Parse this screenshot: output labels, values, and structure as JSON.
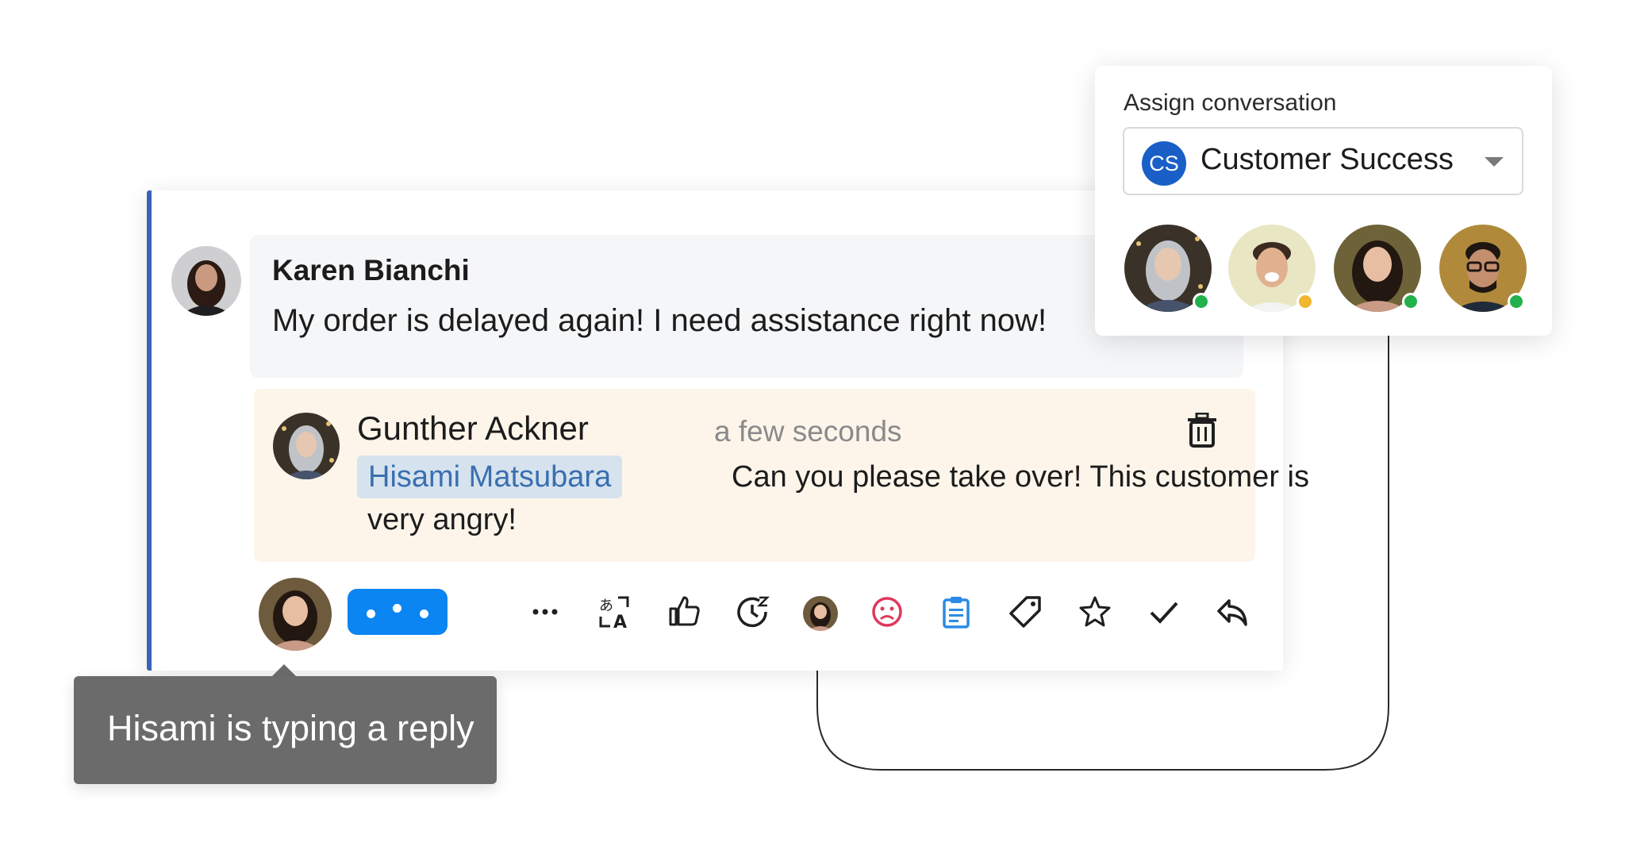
{
  "conversation": {
    "customer_message": {
      "author": "Karen Bianchi",
      "text": "My order is delayed again! I need assistance right now!"
    },
    "internal_note": {
      "author": "Gunther Ackner",
      "time": "a few seconds",
      "mention": "Hisami Matsubara",
      "text_line1": "Can you please take over! This customer is",
      "text_line2": "very angry!"
    },
    "toolbar": {
      "icons": [
        "more-icon",
        "translate-icon",
        "thumbs-up-icon",
        "snooze-icon",
        "assignee-avatar",
        "sad-face-icon",
        "clipboard-icon",
        "tag-icon",
        "star-icon",
        "check-icon",
        "reply-icon"
      ],
      "sad_face_color": "#e0385c",
      "clipboard_color": "#2a8be6"
    }
  },
  "tooltip": {
    "text": "Hisami is typing a reply"
  },
  "assign": {
    "label": "Assign conversation",
    "team_initials": "CS",
    "team_name": "Customer Success",
    "agents": [
      {
        "name": "agent-1",
        "status": "online",
        "status_color": "#22b14c"
      },
      {
        "name": "agent-2",
        "status": "away",
        "status_color": "#f2b632"
      },
      {
        "name": "agent-3",
        "status": "online",
        "status_color": "#22b14c"
      },
      {
        "name": "agent-4",
        "status": "online",
        "status_color": "#22b14c"
      }
    ]
  },
  "colors": {
    "accent": "#3a62b8",
    "typing_bubble": "#0a85f2",
    "note_background": "#fdf5ea",
    "mention_background": "#d6e3ef"
  }
}
